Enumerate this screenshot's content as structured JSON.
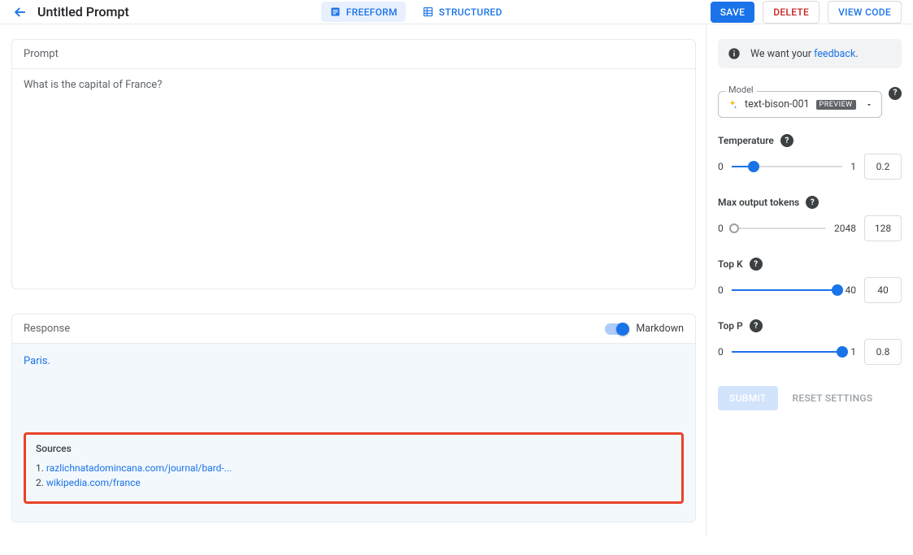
{
  "header": {
    "title": "Untitled Prompt",
    "tabs": {
      "freeform": "FREEFORM",
      "structured": "STRUCTURED"
    },
    "actions": {
      "save": "SAVE",
      "delete": "DELETE",
      "view_code": "VIEW CODE"
    }
  },
  "prompt": {
    "heading": "Prompt",
    "text": "What is the capital of France?"
  },
  "response": {
    "heading": "Response",
    "markdown_label": "Markdown",
    "text": "Paris.",
    "sources_heading": "Sources",
    "sources": [
      {
        "n": "1.",
        "label": "razlichnatadomincana.com/journal/bard-..."
      },
      {
        "n": "2.",
        "label": "wikipedia.com/france"
      }
    ]
  },
  "feedback": {
    "prefix": "We want your ",
    "link": "feedback",
    "suffix": "."
  },
  "model": {
    "legend": "Model",
    "name": "text-bison-001",
    "badge": "PREVIEW"
  },
  "params": {
    "temperature": {
      "label": "Temperature",
      "min": "0",
      "max": "1",
      "value": "0.2",
      "pos": 20
    },
    "max_tokens": {
      "label": "Max output tokens",
      "min": "0",
      "max": "2048",
      "value": "128",
      "pos": 0
    },
    "top_k": {
      "label": "Top K",
      "min": "0",
      "max": "40",
      "value": "40",
      "pos": 100
    },
    "top_p": {
      "label": "Top P",
      "min": "0",
      "max": "1",
      "value": "0.8",
      "pos": 100
    }
  },
  "buttons": {
    "submit": "SUBMIT",
    "reset": "RESET SETTINGS"
  }
}
